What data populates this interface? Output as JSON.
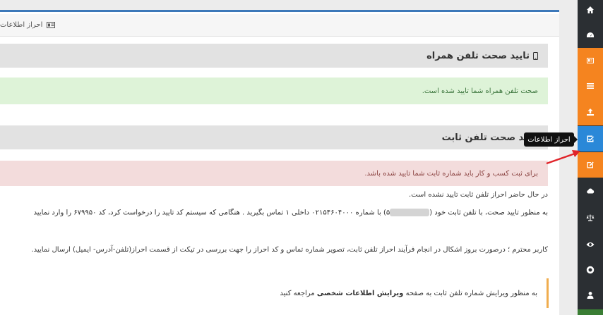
{
  "header": {
    "title": "احراز اطلاعات"
  },
  "mobile_section": {
    "title": "تایید صحت تلفن همراه",
    "status": "صحت تلفن همراه شما تایید شده است."
  },
  "landline_section": {
    "title": "تایید صحت تلفن ثابت",
    "warning": "برای ثبت کسب و کار باید شماره ثابت شما تایید شده باشد.",
    "pending": "در حال حاضر احراز تلفن ثابت تایید نشده است.",
    "instruction_prefix": "به منظور تایید صحت، با تلفن ثابت خود (",
    "instruction_suffix": "۵) با شماره ۰۲۱۵۴۶۰۴۰۰۰ داخلی ۱ تماس بگیرید . هنگامی که سیستم کد تایید را درخواست کرد، کد ۶۷۹۹۵۰ را وارد نمایید",
    "problem": "کاربر محترم ؛ درصورت بروز اشکال در انجام فرآیند احراز تلفن ثابت، تصویر شماره تماس و کد احراز را جهت بررسی در تیکت از قسمت احراز(تلفن-آدرس- ایمیل) ارسال نمایید.",
    "note_prefix": "به منظور ویرایش شماره تلفن ثابت به صفحه",
    "note_link": "ویرایش اطلاعات شخصی",
    "note_suffix": "مراجعه کنید"
  },
  "tooltip": {
    "label": "احراز اطلاعات"
  },
  "sidebar": {
    "items": [
      {
        "icon": "home-icon"
      },
      {
        "icon": "dashboard-icon"
      },
      {
        "icon": "id-card-icon"
      },
      {
        "icon": "list-icon"
      },
      {
        "icon": "upload-icon"
      },
      {
        "icon": "check-square-icon"
      },
      {
        "icon": "edit-icon"
      },
      {
        "icon": "cloud-icon"
      },
      {
        "icon": "balance-scale-icon"
      },
      {
        "icon": "eye-icon"
      },
      {
        "icon": "support-icon"
      },
      {
        "icon": "user-icon"
      }
    ]
  },
  "colors": {
    "sidebar_bg": "#2b2f33",
    "orange": "#f5841f",
    "active_blue": "#2a88d8",
    "panel_border": "#3c78b9",
    "success_bg": "#def3d8",
    "danger_bg": "#f3dcdc",
    "note_border": "#f0ad4e",
    "arrow": "#e0242a"
  }
}
